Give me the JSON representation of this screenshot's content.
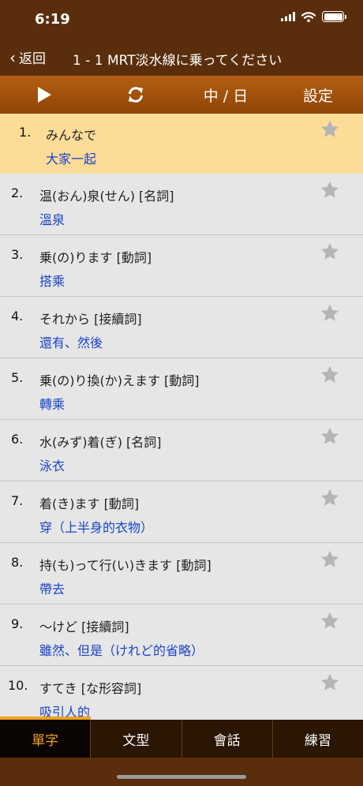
{
  "status": {
    "time": "6:19"
  },
  "nav": {
    "back_label": "返回",
    "title": "1 - 1 MRT淡水線に乗ってください"
  },
  "toolbar": {
    "language_label": "中 / 日",
    "settings_label": "設定"
  },
  "colors": {
    "nav_bg": "#5a2e0c",
    "toolbar_bg": "#a8560e",
    "highlight_row": "#fddc98",
    "meaning_text": "#1a44c8",
    "active_tab": "#f0a020"
  },
  "vocab": [
    {
      "num": "1.",
      "jp": "みんなで",
      "zh": "大家一起"
    },
    {
      "num": "2.",
      "jp": "温(おん)泉(せん)  [名詞]",
      "zh": "溫泉"
    },
    {
      "num": "3.",
      "jp": "乗(の)ります  [動詞]",
      "zh": "搭乘"
    },
    {
      "num": "4.",
      "jp": "それから  [接續詞]",
      "zh": "還有、然後"
    },
    {
      "num": "5.",
      "jp": "乗(の)り換(か)えます  [動詞]",
      "zh": "轉乘"
    },
    {
      "num": "6.",
      "jp": "水(みず)着(ぎ)  [名詞]",
      "zh": "泳衣"
    },
    {
      "num": "7.",
      "jp": "着(き)ます  [動詞]",
      "zh": "穿（上半身的衣物）"
    },
    {
      "num": "8.",
      "jp": "持(も)って行(い)きます  [動詞]",
      "zh": "帶去"
    },
    {
      "num": "9.",
      "jp": "〜けど  [接續詞]",
      "zh": "雖然、但是（けれど的省略）"
    },
    {
      "num": "10.",
      "jp": "すてき  [な形容詞]",
      "zh": "吸引人的"
    }
  ],
  "tabs": [
    {
      "label": "單字"
    },
    {
      "label": "文型"
    },
    {
      "label": "會話"
    },
    {
      "label": "練習"
    }
  ]
}
